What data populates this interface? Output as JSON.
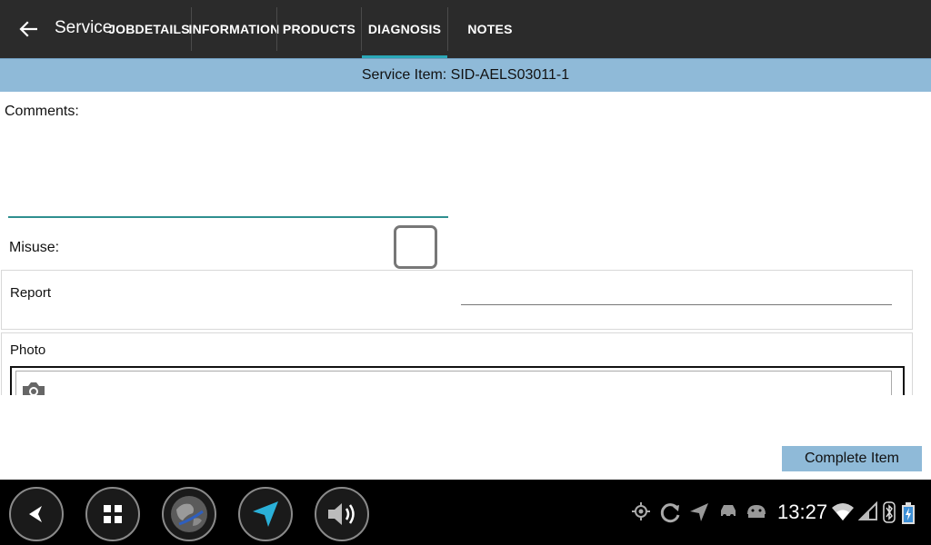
{
  "appbar": {
    "title": "Service",
    "tabs": [
      {
        "label": "JOBDETAILS"
      },
      {
        "label": "INFORMATION"
      },
      {
        "label": "PRODUCTS"
      },
      {
        "label": "DIAGNOSIS",
        "selected": true
      },
      {
        "label": "NOTES"
      }
    ],
    "accent": "#2aa8b8"
  },
  "subheader": {
    "text": "Service Item: SID-AELS03011-1"
  },
  "form": {
    "comments_label": "Comments:",
    "comments_value": "",
    "misuse_label": "Misuse:",
    "misuse_checked": false,
    "report_label": "Report",
    "report_value": "",
    "photo_label": "Photo"
  },
  "actions": {
    "complete_label": "Complete Item"
  },
  "statusbar": {
    "time": "13:27",
    "nav_buttons": [
      "back-icon",
      "apps-grid-icon",
      "globe-icon",
      "navigation-arrow-icon",
      "volume-icon"
    ],
    "status_icons": [
      "gps-icon",
      "sync-icon",
      "location-arrow-icon",
      "car-icon",
      "android-icon",
      "wifi-icon",
      "signal-icon",
      "bluetooth-icon",
      "battery-charging-icon"
    ]
  }
}
